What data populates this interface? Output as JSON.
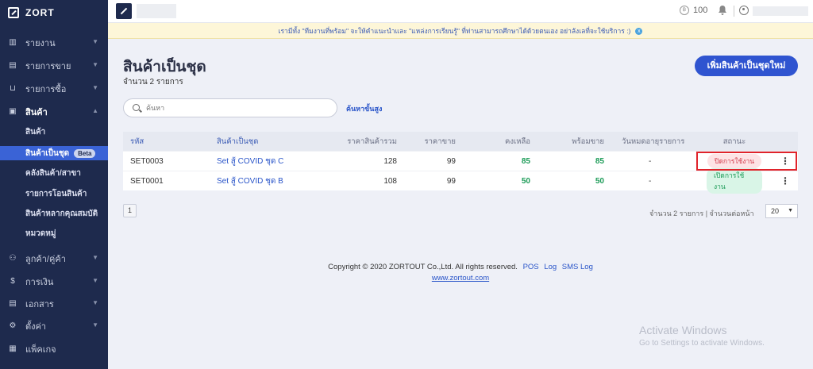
{
  "app": {
    "brand": "ZORT"
  },
  "sidebar": {
    "items": [
      {
        "label": "รายงาน",
        "icon": "chart-icon"
      },
      {
        "label": "รายการขาย",
        "icon": "clipboard-icon"
      },
      {
        "label": "รายการซื้อ",
        "icon": "basket-icon"
      },
      {
        "label": "สินค้า",
        "icon": "box-icon"
      },
      {
        "label": "ลูกค้า/คู่ค้า",
        "icon": "users-icon"
      },
      {
        "label": "การเงิน",
        "icon": "money-icon"
      },
      {
        "label": "เอกสาร",
        "icon": "document-icon"
      },
      {
        "label": "ตั้งค่า",
        "icon": "gear-icon"
      },
      {
        "label": "แพ็คเกจ",
        "icon": "package-icon"
      }
    ],
    "sub_items": [
      {
        "label": "สินค้า"
      },
      {
        "label": "สินค้าเป็นชุด",
        "badge": "Beta"
      },
      {
        "label": "คลังสินค้า/สาขา"
      },
      {
        "label": "รายการโอนสินค้า"
      },
      {
        "label": "สินค้าหลากคุณสมบัติ"
      },
      {
        "label": "หมวดหมู่"
      }
    ]
  },
  "topbar": {
    "credit": "100"
  },
  "announcement": {
    "text": "เรามีทั้ง \"ทีมงานที่พร้อม\" จะให้คำแนะนำและ \"แหล่งการเรียนรู้\" ที่ท่านสามารถศึกษาได้ด้วยตนเอง อย่าลังเลที่จะใช้บริการ :)",
    "close": "x"
  },
  "page": {
    "title": "สินค้าเป็นชุด",
    "subtitle": "จำนวน 2 รายการ",
    "add_button": "เพิ่มสินค้าเป็นชุดใหม่"
  },
  "search": {
    "placeholder": "ค้นหา",
    "value": "",
    "advanced": "ค้นหาขั้นสูง"
  },
  "table": {
    "headers": {
      "code": "รหัส",
      "name": "สินค้าเป็นชุด",
      "total": "ราคาสินค้ารวม",
      "price": "ราคาขาย",
      "remaining": "คงเหลือ",
      "ready": "พร้อมขาย",
      "expiry": "วันหมดอายุรายการ",
      "status": "สถานะ"
    },
    "rows": [
      {
        "code": "SET0003",
        "name": "Set สู้ COVID ชุด C",
        "total": "128",
        "price": "99",
        "remaining": "85",
        "ready": "85",
        "expiry": "-",
        "status": "ปิดการใช้งาน"
      },
      {
        "code": "SET0001",
        "name": "Set สู้ COVID ชุด B",
        "total": "108",
        "price": "99",
        "remaining": "50",
        "ready": "50",
        "expiry": "-",
        "status": "เปิดการใช้งาน"
      }
    ],
    "row_menu": "⋮"
  },
  "pagination": {
    "page": "1",
    "info": "จำนวน 2 รายการ | จำนวนต่อหน้า",
    "per_page": "20"
  },
  "footer": {
    "copyright": "Copyright © 2020 ZORTOUT Co.,Ltd. All rights reserved.",
    "links": [
      "POS",
      "Log",
      "SMS Log"
    ],
    "site": "www.zortout.com"
  },
  "watermark": {
    "title": "Activate Windows",
    "subtitle": "Go to Settings to activate Windows."
  },
  "colors": {
    "sidebar": "#1e2a4d",
    "accent": "#2f54d0",
    "active_sub": "#3a63d6",
    "green": "#1c9b57",
    "red": "#d33a4a",
    "highlight": "#e0232b"
  }
}
